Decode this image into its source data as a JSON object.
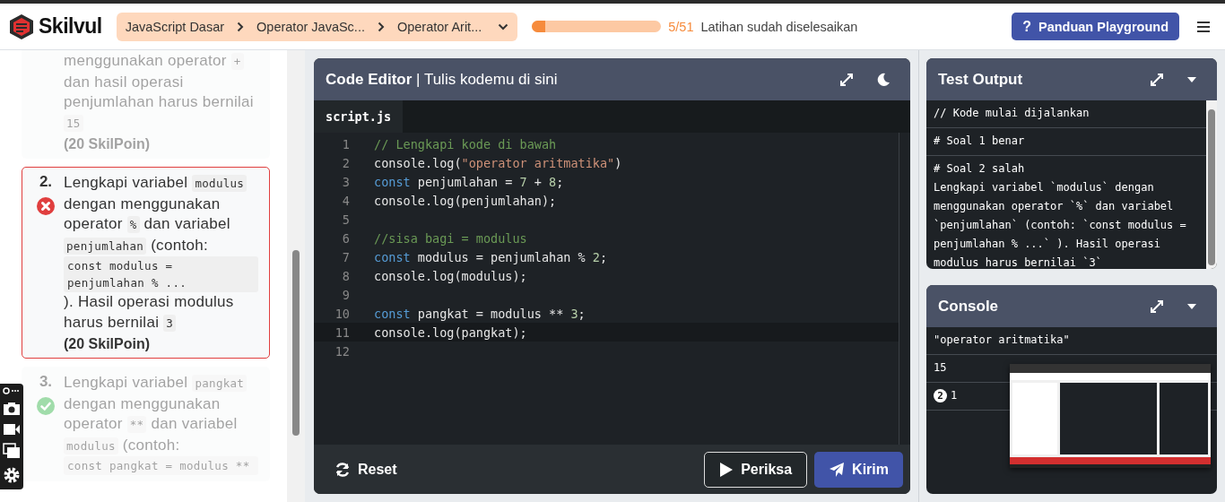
{
  "brand": {
    "name": "Skilvul"
  },
  "breadcrumb": [
    "JavaScript Dasar",
    "Operator JavaSc...",
    "Operator Arit..."
  ],
  "progress": {
    "level": 0.1,
    "count": "5/51",
    "label": "Latihan sudah diselesaikan"
  },
  "guide_button": {
    "icon": "?",
    "label": "Panduan Playground"
  },
  "tasks": [
    {
      "selected": false,
      "segments": [
        {
          "kind": "text",
          "text": "menggunakan operator"
        },
        {
          "kind": "code",
          "text": "+"
        },
        {
          "kind": "text",
          "text": "dan hasil operasi penjumlahan harus bernilai"
        },
        {
          "kind": "code",
          "text": "15"
        }
      ],
      "points": "(20 SkilPoin)"
    },
    {
      "selected": true,
      "number": "2.",
      "kind": "failed",
      "segments": [
        {
          "kind": "text",
          "text": "Lengkapi variabel"
        },
        {
          "kind": "code",
          "text": "modulus"
        },
        {
          "kind": "text",
          "text": "dengan menggunakan operator"
        },
        {
          "kind": "code",
          "text": "%"
        },
        {
          "kind": "text",
          "text": "dan variabel"
        },
        {
          "kind": "code",
          "text": "penjumlahan"
        },
        {
          "kind": "text",
          "text": "(contoh:"
        },
        {
          "kind": "block",
          "text": "const modulus = penjumlahan % ..."
        },
        {
          "kind": "text",
          "text": "). Hasil operasi modulus harus bernilai"
        },
        {
          "kind": "code",
          "text": "3"
        }
      ],
      "points": "(20 SkilPoin)"
    },
    {
      "selected": false,
      "number": "3.",
      "kind": "passed",
      "segments": [
        {
          "kind": "text",
          "text": "Lengkapi variabel"
        },
        {
          "kind": "code",
          "text": "pangkat"
        },
        {
          "kind": "text",
          "text": "dengan menggunakan operator"
        },
        {
          "kind": "code",
          "text": "**"
        },
        {
          "kind": "text",
          "text": "dan variabel"
        },
        {
          "kind": "code",
          "text": "modulus"
        },
        {
          "kind": "text",
          "text": "(contoh:"
        },
        {
          "kind": "block",
          "text": "const pangkat = modulus **"
        }
      ]
    }
  ],
  "editor": {
    "title_bold": "Code Editor",
    "title_rest": "| Tulis kodemu di sini",
    "tab": "script.js",
    "lines": [
      {
        "n": "1",
        "tokens": [
          {
            "kind": "comment",
            "t": "// Lengkapi kode di bawah"
          }
        ]
      },
      {
        "n": "2",
        "tokens": [
          {
            "kind": "plain",
            "t": "console.log("
          },
          {
            "kind": "string",
            "t": "\"operator aritmatika\""
          },
          {
            "kind": "plain",
            "t": ")"
          }
        ]
      },
      {
        "n": "3",
        "tokens": [
          {
            "kind": "keyword",
            "t": "const"
          },
          {
            "kind": "plain",
            "t": " penjumlahan = "
          },
          {
            "kind": "number",
            "t": "7"
          },
          {
            "kind": "plain",
            "t": " + "
          },
          {
            "kind": "number",
            "t": "8"
          },
          {
            "kind": "plain",
            "t": ";"
          }
        ]
      },
      {
        "n": "4",
        "tokens": [
          {
            "kind": "plain",
            "t": "console.log(penjumlahan);"
          }
        ]
      },
      {
        "n": "5"
      },
      {
        "n": "6",
        "tokens": [
          {
            "kind": "comment",
            "t": "//sisa bagi = modulus"
          }
        ]
      },
      {
        "n": "7",
        "tokens": [
          {
            "kind": "keyword",
            "t": "const"
          },
          {
            "kind": "plain",
            "t": " modulus = penjumlahan % "
          },
          {
            "kind": "number",
            "t": "2"
          },
          {
            "kind": "plain",
            "t": ";"
          }
        ]
      },
      {
        "n": "8",
        "tokens": [
          {
            "kind": "plain",
            "t": "console.log(modulus);"
          }
        ]
      },
      {
        "n": "9"
      },
      {
        "n": "10",
        "tokens": [
          {
            "kind": "keyword",
            "t": "const"
          },
          {
            "kind": "plain",
            "t": " pangkat = modulus ** "
          },
          {
            "kind": "number",
            "t": "3"
          },
          {
            "kind": "plain",
            "t": ";"
          }
        ]
      },
      {
        "n": "11",
        "active": true,
        "tokens": [
          {
            "kind": "plain",
            "t": "console.log(pangkat);"
          }
        ]
      },
      {
        "n": "12"
      }
    ],
    "buttons": {
      "reset": "Reset",
      "check": "Periksa",
      "submit": "Kirim"
    }
  },
  "test_output": {
    "title": "Test Output",
    "rows": [
      {
        "title": "// Kode mulai dijalankan"
      },
      {
        "title": "# Soal 1 benar"
      },
      {
        "title": "# Soal 2 salah",
        "detail": "Lengkapi variabel `modulus` dengan menggunakan operator `%` dan variabel `penjumlahan` (contoh: `const modulus = penjumlahan % ...` ). Hasil operasi modulus harus bernilai `3`"
      }
    ]
  },
  "console": {
    "title": "Console",
    "rows": [
      {
        "text": "\"operator aritmatika\""
      },
      {
        "text": "15"
      },
      {
        "count": "2",
        "text": "1"
      }
    ]
  }
}
